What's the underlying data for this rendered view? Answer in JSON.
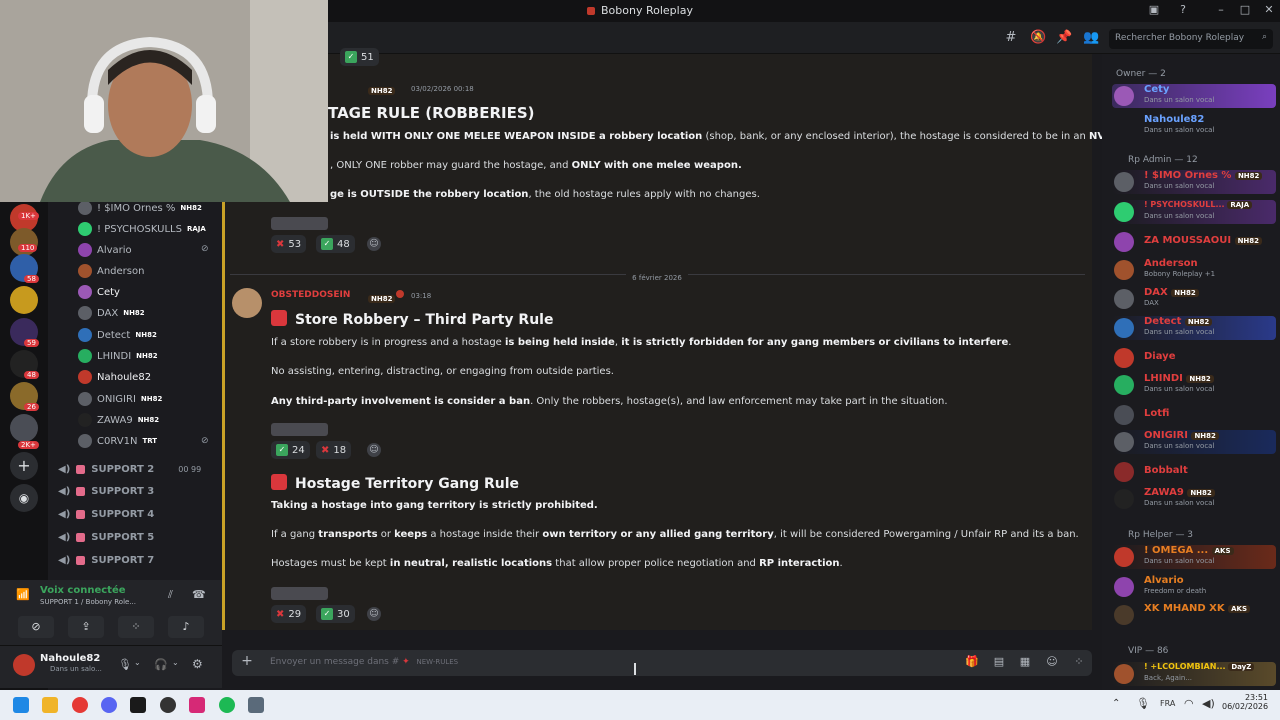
{
  "window": {
    "title": "Bobony Roleplay"
  },
  "header": {
    "search_placeholder": "Rechercher Bobony Roleplay"
  },
  "rail": {
    "badges": [
      "1K+",
      "110",
      "58",
      "59",
      "48",
      "26",
      "2K+"
    ]
  },
  "sidebar": {
    "voice_users": [
      {
        "name": "! $IMO Ornes %",
        "tag": "NH82"
      },
      {
        "name": "! PSYCHOSKULLS",
        "tag": "RAJA"
      },
      {
        "name": "Alvario",
        "tag": ""
      },
      {
        "name": "Anderson",
        "tag": ""
      },
      {
        "name": "Cety",
        "tag": ""
      },
      {
        "name": "DAX",
        "tag": "NH82"
      },
      {
        "name": "Detect",
        "tag": "NH82"
      },
      {
        "name": "LHINDI",
        "tag": "NH82"
      },
      {
        "name": "Nahoule82",
        "tag": ""
      },
      {
        "name": "ONIGIRI",
        "tag": "NH82"
      },
      {
        "name": "ZAWA9",
        "tag": "NH82"
      },
      {
        "name": "C0RV1N",
        "tag": "TRT"
      }
    ],
    "support_channels": [
      "SUPPORT 2",
      "SUPPORT 3",
      "SUPPORT 4",
      "SUPPORT 5",
      "SUPPORT 7"
    ],
    "support2_counts": "00  99"
  },
  "voice_panel": {
    "status": "Voix connectée",
    "channel": "SUPPORT 1 / Bobony Role..."
  },
  "user_panel": {
    "name": "Nahoule82",
    "status": "Dans un salo..."
  },
  "chat": {
    "msg1": {
      "count_top": "51",
      "timestamp": "03/02/2026 00:18",
      "tag": "NH82",
      "title": "TAGE RULE (ROBBERIES)",
      "line1_a": " is held WITH ONLY ONE MELEE WEAPON INSIDE a robbery location",
      "line1_b": " (shop, bank, or any enclosed interior), the hostage is considered to be in an ",
      "line1_c": "NVL situation",
      "line1_d": ".",
      "line2_a": ", ONLY ONE robber may guard the hostage, and ",
      "line2_b": "ONLY with one melee weapon.",
      "line3_a": "ge is OUTSIDE the robbery location",
      "line3_b": ", the old hostage rules apply with no changes.",
      "react_x": "53",
      "react_check": "48"
    },
    "date_divider": "6 février 2026",
    "msg2": {
      "author": "OBSTEDDOSEIN",
      "tag": "NH82",
      "timestamp": "03:18",
      "title": "Store Robbery – Third Party Rule",
      "p1_a": "If a store robbery is in progress and a hostage ",
      "p1_b": "is being held inside",
      "p1_c": ", ",
      "p1_d": "it is strictly forbidden for any gang members or civilians to interfere",
      "p1_e": ".",
      "p2": "No assisting, entering, distracting, or engaging from outside parties.",
      "p3_a": "Any third-party involvement is consider a ban",
      "p3_b": ". Only the robbers, hostage(s), and law enforcement may take part in the situation.",
      "react_check": "24",
      "react_x": "18"
    },
    "msg3": {
      "title": "Hostage Territory Gang Rule",
      "p1": "Taking a hostage into gang territory is strictly prohibited.",
      "p2_a": "If a gang ",
      "p2_b": "transports",
      "p2_c": " or ",
      "p2_d": "keeps",
      "p2_e": " a hostage inside their ",
      "p2_f": "own territory or any allied gang territory",
      "p2_g": ", it will be considered Powergaming / Unfair RP and its a ban.",
      "p3_a": "Hostages must be kept ",
      "p3_b": "in neutral, realistic locations",
      "p3_c": " that allow proper police negotiation and ",
      "p3_d": "RP interaction",
      "p3_e": ".",
      "react_x": "29",
      "react_check": "30"
    },
    "composer_placeholder": "Envoyer un message dans #",
    "composer_channel": "NEW-RULES"
  },
  "members": {
    "group_owner": "Owner — 2",
    "owner": [
      {
        "name": "Cety",
        "status": "Dans un salon vocal",
        "color": "#6aa2ff"
      },
      {
        "name": "Nahoule82",
        "status": "Dans un salon vocal",
        "color": "#6aa2ff"
      }
    ],
    "group_admin": "Rp Admin — 12",
    "admins": [
      {
        "name": "! $IMO Ornes %",
        "tag": "NH82",
        "status": "Dans un salon vocal",
        "color": "#e03e3e"
      },
      {
        "name": "! PSYCHOSKULL...",
        "tag": "RAJA",
        "status": "Dans un salon vocal",
        "color": "#e03e3e"
      },
      {
        "name": "ZA MOUSSAOUI",
        "tag": "NH82",
        "status": "",
        "color": "#e03e3e"
      },
      {
        "name": "Anderson",
        "tag": "",
        "status": "Bobony Roleplay +1",
        "color": "#e03e3e"
      },
      {
        "name": "DAX",
        "tag": "NH82",
        "status": "DAX",
        "color": "#e03e3e"
      },
      {
        "name": "Detect",
        "tag": "NH82",
        "status": "Dans un salon vocal",
        "color": "#e03e3e"
      },
      {
        "name": "Diaye",
        "tag": "",
        "status": "",
        "color": "#e03e3e"
      },
      {
        "name": "LHINDI",
        "tag": "NH82",
        "status": "Dans un salon vocal",
        "color": "#e03e3e"
      },
      {
        "name": "Lotfi",
        "tag": "",
        "status": "",
        "color": "#e03e3e"
      },
      {
        "name": "ONIGIRI",
        "tag": "NH82",
        "status": "Dans un salon vocal",
        "color": "#e03e3e"
      },
      {
        "name": "Bobbalt",
        "tag": "",
        "status": "",
        "color": "#e03e3e"
      },
      {
        "name": "ZAWA9",
        "tag": "NH82",
        "status": "Dans un salon vocal",
        "color": "#e03e3e"
      }
    ],
    "group_helper": "Rp Helper — 3",
    "helpers": [
      {
        "name": "! OMEGA ...",
        "tag": "AKS",
        "status": "Dans un salon vocal",
        "color": "#e67e22"
      },
      {
        "name": "Alvario",
        "tag": "",
        "status": "Freedom or death",
        "color": "#e67e22"
      },
      {
        "name": "XK MHAND XK",
        "tag": "AKS",
        "status": "",
        "color": "#e67e22"
      }
    ],
    "group_vip": "VIP — 86",
    "vip": [
      {
        "name": "! +LCOLOMBIAN...",
        "tag": "DayZ",
        "status": "Back, Again...",
        "color": "#f1c40f"
      }
    ]
  },
  "taskbar": {
    "lang": "FRA",
    "time": "23:51",
    "date": "06/02/2026"
  },
  "colors": {
    "accent_red": "#e03e3e",
    "check_green": "#3ba55d",
    "chat_bg": "#211f1d"
  }
}
